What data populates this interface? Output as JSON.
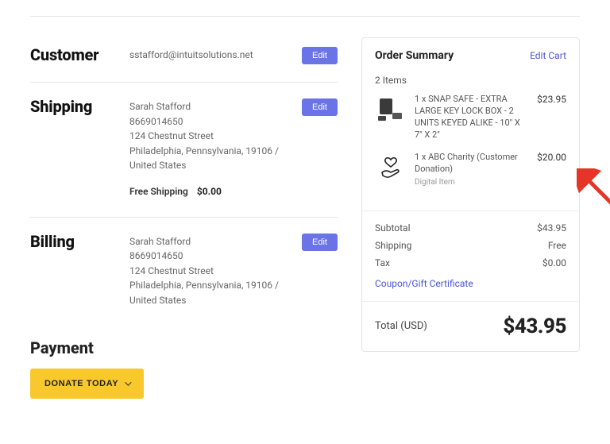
{
  "customer": {
    "heading": "Customer",
    "email": "sstafford@intuitsolutions.net",
    "edit_label": "Edit"
  },
  "shipping": {
    "heading": "Shipping",
    "name": "Sarah Stafford",
    "phone": "8669014650",
    "street": "124 Chestnut Street",
    "city_line": "Philadelphia, Pennsylvania, 19106 /",
    "country": "United States",
    "method_label": "Free Shipping",
    "method_cost": "$0.00",
    "edit_label": "Edit"
  },
  "billing": {
    "heading": "Billing",
    "name": "Sarah Stafford",
    "phone": "8669014650",
    "street": "124 Chestnut Street",
    "city_line": "Philadelphia, Pennsylvania, 19106 /",
    "country": "United States",
    "edit_label": "Edit"
  },
  "payment": {
    "heading": "Payment",
    "donate_label": "DONATE TODAY"
  },
  "summary": {
    "heading": "Order Summary",
    "edit_cart_label": "Edit Cart",
    "item_count": "2 Items",
    "items": [
      {
        "desc": "1 x SNAP SAFE - EXTRA LARGE KEY LOCK BOX - 2 UNITS KEYED ALIKE - 10\" X 7\" X 2\"",
        "sub": "",
        "price": "$23.95"
      },
      {
        "desc": "1 x ABC Charity (Customer Donation)",
        "sub": "Digital Item",
        "price": "$20.00"
      }
    ],
    "subtotal_label": "Subtotal",
    "subtotal_value": "$43.95",
    "shipping_label": "Shipping",
    "shipping_value": "Free",
    "tax_label": "Tax",
    "tax_value": "$0.00",
    "coupon_label": "Coupon/Gift Certificate",
    "total_label": "Total (USD)",
    "total_value": "$43.95"
  }
}
